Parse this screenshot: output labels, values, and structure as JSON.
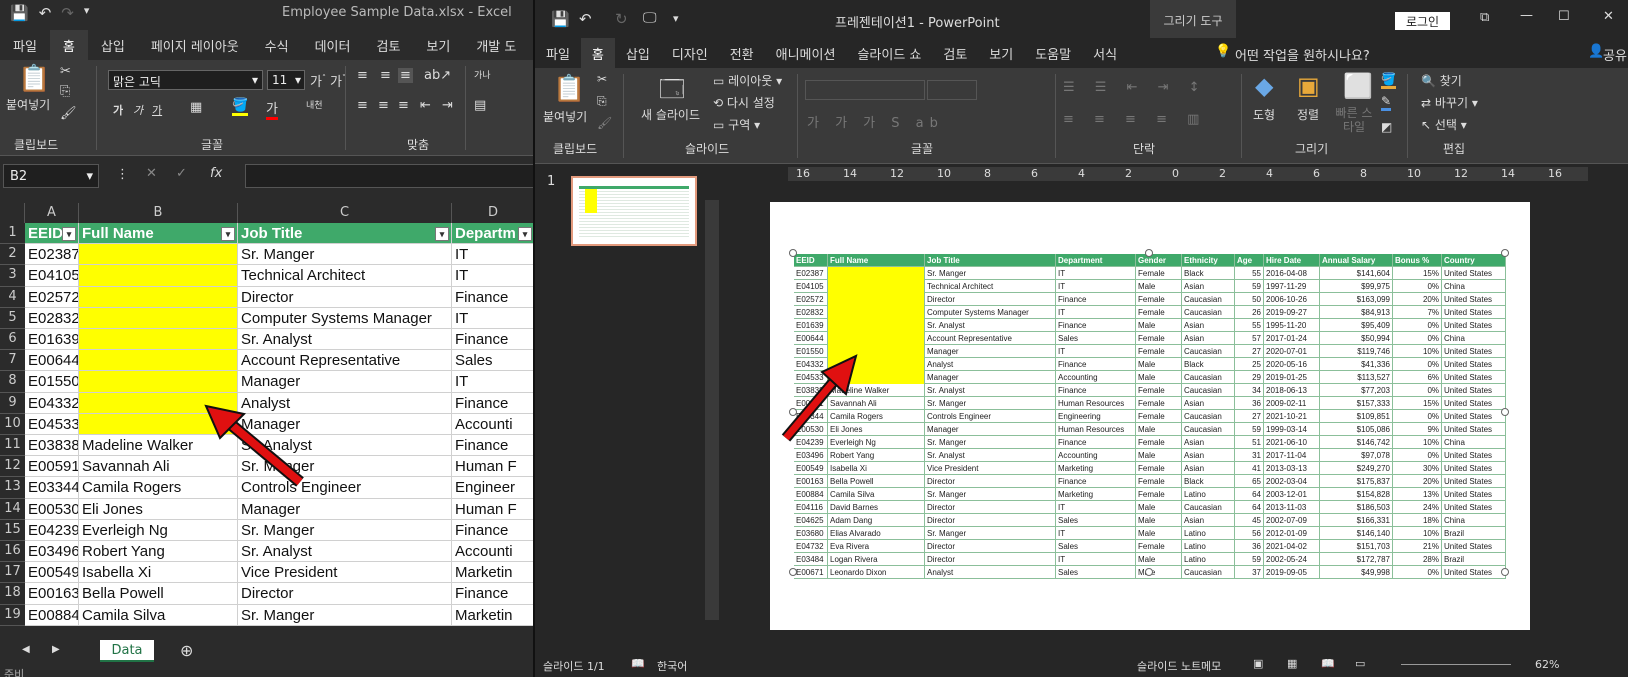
{
  "excel": {
    "window_title": "Employee Sample Data.xlsx  -  Excel",
    "tabs": [
      "파일",
      "홈",
      "삽입",
      "페이지 레이아웃",
      "수식",
      "데이터",
      "검토",
      "보기",
      "개발 도"
    ],
    "active_tab": "홈",
    "ribbon": {
      "paste_label": "붙여넣기",
      "font_name": "맑은 고딕",
      "font_size": "11",
      "groups": [
        "클립보드",
        "글꼴",
        "맞춤"
      ],
      "bold": "가",
      "italic": "가",
      "underline": "가",
      "wrap": "가나",
      "inner": "내천"
    },
    "name_box": "B2",
    "fx_label": "fx",
    "column_letters": [
      "A",
      "B",
      "C",
      "D"
    ],
    "headers": [
      "EEID",
      "Full Name",
      "Job Title",
      "Departm"
    ],
    "rows": [
      {
        "n": "2",
        "eeid": "E02387",
        "name": "",
        "title": "Sr. Manger",
        "dept": "IT"
      },
      {
        "n": "3",
        "eeid": "E04105",
        "name": "",
        "title": "Technical Architect",
        "dept": "IT"
      },
      {
        "n": "4",
        "eeid": "E02572",
        "name": "",
        "title": "Director",
        "dept": "Finance"
      },
      {
        "n": "5",
        "eeid": "E02832",
        "name": "",
        "title": "Computer Systems Manager",
        "dept": "IT"
      },
      {
        "n": "6",
        "eeid": "E01639",
        "name": "",
        "title": "Sr. Analyst",
        "dept": "Finance"
      },
      {
        "n": "7",
        "eeid": "E00644",
        "name": "",
        "title": "Account Representative",
        "dept": "Sales"
      },
      {
        "n": "8",
        "eeid": "E01550",
        "name": "",
        "title": "Manager",
        "dept": "IT"
      },
      {
        "n": "9",
        "eeid": "E04332",
        "name": "",
        "title": "Analyst",
        "dept": "Finance"
      },
      {
        "n": "10",
        "eeid": "E04533",
        "name": "",
        "title": "Manager",
        "dept": "Accounti"
      },
      {
        "n": "11",
        "eeid": "E03838",
        "name": "Madeline Walker",
        "title": "Sr. Analyst",
        "dept": "Finance"
      },
      {
        "n": "12",
        "eeid": "E00591",
        "name": "Savannah Ali",
        "title": "Sr. Manger",
        "dept": "Human F"
      },
      {
        "n": "13",
        "eeid": "E03344",
        "name": "Camila Rogers",
        "title": "Controls Engineer",
        "dept": "Engineer"
      },
      {
        "n": "14",
        "eeid": "E00530",
        "name": "Eli Jones",
        "title": "Manager",
        "dept": "Human F"
      },
      {
        "n": "15",
        "eeid": "E04239",
        "name": "Everleigh Ng",
        "title": "Sr. Manger",
        "dept": "Finance"
      },
      {
        "n": "16",
        "eeid": "E03496",
        "name": "Robert Yang",
        "title": "Sr. Analyst",
        "dept": "Accounti"
      },
      {
        "n": "17",
        "eeid": "E00549",
        "name": "Isabella Xi",
        "title": "Vice President",
        "dept": "Marketin"
      },
      {
        "n": "18",
        "eeid": "E00163",
        "name": "Bella Powell",
        "title": "Director",
        "dept": "Finance"
      },
      {
        "n": "19",
        "eeid": "E00884",
        "name": "Camila Silva",
        "title": "Sr. Manger",
        "dept": "Marketin"
      }
    ],
    "sheet_tab": "Data",
    "status": "준비"
  },
  "ppt": {
    "window_title": "프레젠테이션1  -  PowerPoint",
    "context_tab": "그리기 도구",
    "login_label": "로그인",
    "tabs": [
      "파일",
      "홈",
      "삽입",
      "디자인",
      "전환",
      "애니메이션",
      "슬라이드 쇼",
      "검토",
      "보기",
      "도움말",
      "서식"
    ],
    "active_tab": "홈",
    "search_label": "어떤 작업을 원하시나요?",
    "share_label": "공유",
    "ribbon": {
      "paste_label": "붙여넣기",
      "new_slide_label": "새 슬라이드",
      "layout_label": "레이아웃",
      "reset_label": "다시 설정",
      "section_label": "구역",
      "shape_label": "도형",
      "arrange_label": "정렬",
      "quick_style_label": "빠른 스타일",
      "find_label": "찾기",
      "replace_label": "바꾸기",
      "select_label": "선택",
      "groups": [
        "클립보드",
        "슬라이드",
        "글꼴",
        "단락",
        "그리기",
        "편집"
      ]
    },
    "slide_number": "1",
    "status_slide": "슬라이드 1/1",
    "status_lang": "한국어",
    "status_notes": "슬라이드 노트",
    "status_comments": "메모",
    "zoom": "62%",
    "table_headers": [
      "EEID",
      "Full Name",
      "Job Title",
      "Department",
      "Gender",
      "Ethnicity",
      "Age",
      "Hire Date",
      "Annual Salary",
      "Bonus %",
      "Country"
    ],
    "table_rows": [
      [
        "E02387",
        "",
        "Sr. Manger",
        "IT",
        "Female",
        "Black",
        "55",
        "2016-04-08",
        "$141,604",
        "15%",
        "United States"
      ],
      [
        "E04105",
        "",
        "Technical Architect",
        "IT",
        "Male",
        "Asian",
        "59",
        "1997-11-29",
        "$99,975",
        "0%",
        "China"
      ],
      [
        "E02572",
        "",
        "Director",
        "Finance",
        "Female",
        "Caucasian",
        "50",
        "2006-10-26",
        "$163,099",
        "20%",
        "United States"
      ],
      [
        "E02832",
        "",
        "Computer Systems Manager",
        "IT",
        "Female",
        "Caucasian",
        "26",
        "2019-09-27",
        "$84,913",
        "7%",
        "United States"
      ],
      [
        "E01639",
        "",
        "Sr. Analyst",
        "Finance",
        "Male",
        "Asian",
        "55",
        "1995-11-20",
        "$95,409",
        "0%",
        "United States"
      ],
      [
        "E00644",
        "",
        "Account Representative",
        "Sales",
        "Female",
        "Asian",
        "57",
        "2017-01-24",
        "$50,994",
        "0%",
        "China"
      ],
      [
        "E01550",
        "",
        "Manager",
        "IT",
        "Female",
        "Caucasian",
        "27",
        "2020-07-01",
        "$119,746",
        "10%",
        "United States"
      ],
      [
        "E04332",
        "",
        "Analyst",
        "Finance",
        "Male",
        "Black",
        "25",
        "2020-05-16",
        "$41,336",
        "0%",
        "United States"
      ],
      [
        "E04533",
        "",
        "Manager",
        "Accounting",
        "Male",
        "Caucasian",
        "29",
        "2019-01-25",
        "$113,527",
        "6%",
        "United States"
      ],
      [
        "E03838",
        "Madeline Walker",
        "Sr. Analyst",
        "Finance",
        "Female",
        "Caucasian",
        "34",
        "2018-06-13",
        "$77,203",
        "0%",
        "United States"
      ],
      [
        "E00591",
        "Savannah Ali",
        "Sr. Manger",
        "Human Resources",
        "Female",
        "Asian",
        "36",
        "2009-02-11",
        "$157,333",
        "15%",
        "United States"
      ],
      [
        "E03344",
        "Camila Rogers",
        "Controls Engineer",
        "Engineering",
        "Female",
        "Caucasian",
        "27",
        "2021-10-21",
        "$109,851",
        "0%",
        "United States"
      ],
      [
        "E00530",
        "Eli Jones",
        "Manager",
        "Human Resources",
        "Male",
        "Caucasian",
        "59",
        "1999-03-14",
        "$105,086",
        "9%",
        "United States"
      ],
      [
        "E04239",
        "Everleigh Ng",
        "Sr. Manger",
        "Finance",
        "Female",
        "Asian",
        "51",
        "2021-06-10",
        "$146,742",
        "10%",
        "China"
      ],
      [
        "E03496",
        "Robert Yang",
        "Sr. Analyst",
        "Accounting",
        "Male",
        "Asian",
        "31",
        "2017-11-04",
        "$97,078",
        "0%",
        "United States"
      ],
      [
        "E00549",
        "Isabella Xi",
        "Vice President",
        "Marketing",
        "Female",
        "Asian",
        "41",
        "2013-03-13",
        "$249,270",
        "30%",
        "United States"
      ],
      [
        "E00163",
        "Bella Powell",
        "Director",
        "Finance",
        "Female",
        "Black",
        "65",
        "2002-03-04",
        "$175,837",
        "20%",
        "United States"
      ],
      [
        "E00884",
        "Camila Silva",
        "Sr. Manger",
        "Marketing",
        "Female",
        "Latino",
        "64",
        "2003-12-01",
        "$154,828",
        "13%",
        "United States"
      ],
      [
        "E04116",
        "David Barnes",
        "Director",
        "IT",
        "Male",
        "Caucasian",
        "64",
        "2013-11-03",
        "$186,503",
        "24%",
        "United States"
      ],
      [
        "E04625",
        "Adam Dang",
        "Director",
        "Sales",
        "Male",
        "Asian",
        "45",
        "2002-07-09",
        "$166,331",
        "18%",
        "China"
      ],
      [
        "E03680",
        "Elias Alvarado",
        "Sr. Manger",
        "IT",
        "Male",
        "Latino",
        "56",
        "2012-01-09",
        "$146,140",
        "10%",
        "Brazil"
      ],
      [
        "E04732",
        "Eva Rivera",
        "Director",
        "Sales",
        "Female",
        "Latino",
        "36",
        "2021-04-02",
        "$151,703",
        "21%",
        "United States"
      ],
      [
        "E03484",
        "Logan Rivera",
        "Director",
        "IT",
        "Male",
        "Latino",
        "59",
        "2002-05-24",
        "$172,787",
        "28%",
        "Brazil"
      ],
      [
        "E00671",
        "Leonardo Dixon",
        "Analyst",
        "Sales",
        "Male",
        "Caucasian",
        "37",
        "2019-09-05",
        "$49,998",
        "0%",
        "United States"
      ]
    ],
    "ruler_h": [
      "16",
      "14",
      "12",
      "10",
      "8",
      "6",
      "4",
      "2",
      "0",
      "2",
      "4",
      "6",
      "8",
      "10",
      "12",
      "14",
      "16"
    ]
  },
  "colors": {
    "header_green": "#3fa96a",
    "highlight_yellow": "#ffff00",
    "arrow_red": "#e01010"
  }
}
